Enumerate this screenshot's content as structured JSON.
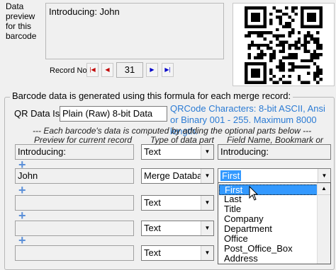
{
  "preview": {
    "label": "Data preview for this barcode",
    "text": "Introducing: John"
  },
  "record": {
    "label": "Record No",
    "value": "31",
    "nav": [
      "|◀",
      "◀",
      "▶",
      "▶|"
    ]
  },
  "group": {
    "title": "Barcode data is generated using this formula for each merge record:",
    "qr_label": "QR Data Is",
    "qr_type": "Plain (Raw) 8-bit Data",
    "info": "QRCode   Characters: 8-bit ASCII, Ansi or Binary 001 - 255.  Maximum 8000 length.",
    "computed_note": "--- Each barcode's data is computed by adding the optional parts below ---",
    "headers": {
      "preview": "Preview for current record",
      "type": "Type of data part",
      "field": "Field Name, Bookmark or Text"
    },
    "rows": [
      {
        "preview": "Introducing:",
        "type": "Text",
        "field": "Introducing:"
      },
      {
        "preview": "John",
        "type": "Merge Database",
        "field": "First"
      },
      {
        "preview": "",
        "type": "Text",
        "field": ""
      },
      {
        "preview": "",
        "type": "Text",
        "field": ""
      },
      {
        "preview": "",
        "type": "Text",
        "field": ""
      }
    ],
    "plus": "+"
  },
  "dropdown_options": [
    "First",
    "Last",
    "Title",
    "Company",
    "Department",
    "Office",
    "Post_Office_Box",
    "Address"
  ],
  "icons": {
    "dropdown": "chevron-down-icon",
    "scroll_up": "scroll-up-icon"
  }
}
